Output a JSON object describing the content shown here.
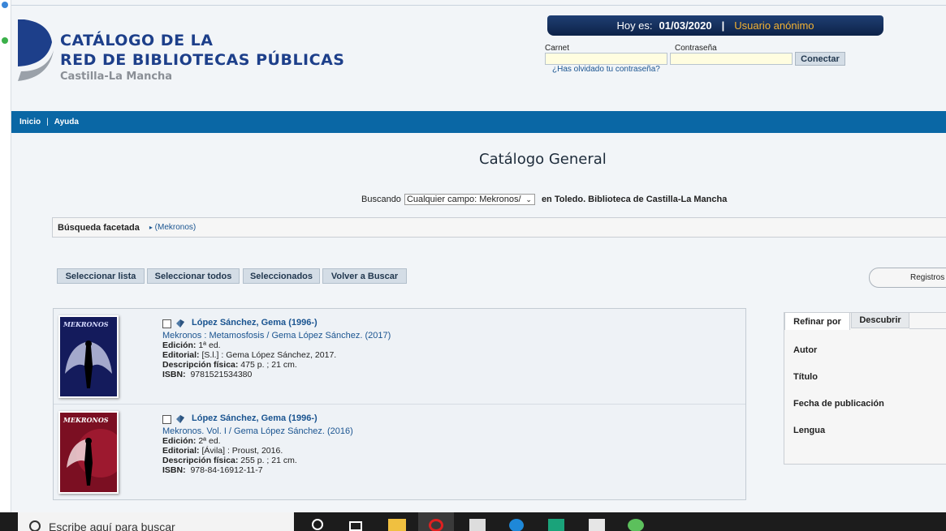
{
  "header": {
    "logo_line1": "CATÁLOGO DE LA",
    "logo_line2": "RED DE BIBLIOTECAS PÚBLICAS",
    "logo_sub": "Castilla-La Mancha",
    "date_label": "Hoy es:",
    "date_value": "01/03/2020",
    "separator": "|",
    "user_label": "Usuario anónimo",
    "carnet_label": "Carnet",
    "password_label": "Contraseña",
    "login_button": "Conectar",
    "forgot_link": "¿Has olvidado tu contraseña?"
  },
  "nav": {
    "home": "Inicio",
    "separator": "|",
    "help": "Ayuda"
  },
  "main": {
    "page_title": "Catálogo General",
    "search_prefix": "Buscando",
    "search_select_value": "Cualquier campo: Mekronos/",
    "search_location": "en Toledo. Biblioteca de Castilla-La Mancha",
    "facet_label": "Búsqueda facetada",
    "facet_crumb": "(Mekronos)",
    "actions": {
      "select_list": "Seleccionar lista",
      "select_all": "Seleccionar todos",
      "selected": "Seleccionados",
      "back_to_search": "Volver a Buscar"
    },
    "registros_label": "Registros"
  },
  "records": [
    {
      "author": "López Sánchez, Gema (1996-)",
      "title": "Mekronos : Metamosfosis / Gema López Sánchez. (2017)",
      "edition_label": "Edición:",
      "edition": "1ª ed.",
      "publisher_label": "Editorial:",
      "publisher": "[S.l.] : Gema López Sánchez, 2017.",
      "physical_label": "Descripción física:",
      "physical": "475 p. ; 21 cm.",
      "isbn_label": "ISBN:",
      "isbn": "9781521534380",
      "cover_color": "#1a1f6e"
    },
    {
      "author": "López Sánchez, Gema (1996-)",
      "title": "Mekronos. Vol. I / Gema López Sánchez. (2016)",
      "edition_label": "Edición:",
      "edition": "2ª ed.",
      "publisher_label": "Editorial:",
      "publisher": "[Ávila] : Proust, 2016.",
      "physical_label": "Descripción física:",
      "physical": "255 p. ; 21 cm.",
      "isbn_label": "ISBN:",
      "isbn": "978-84-16912-11-7",
      "cover_color": "#8e1426"
    }
  ],
  "refine": {
    "tab_refine": "Refinar por",
    "tab_discover": "Descubrir",
    "facets": [
      "Autor",
      "Título",
      "Fecha de publicación",
      "Lengua"
    ]
  },
  "taskbar": {
    "search_placeholder": "Escribe aquí para buscar"
  },
  "colors": {
    "nav_blue": "#0a67a5",
    "link_blue": "#1a5490",
    "header_navy": "#0d2248",
    "user_orange": "#f3b232"
  }
}
